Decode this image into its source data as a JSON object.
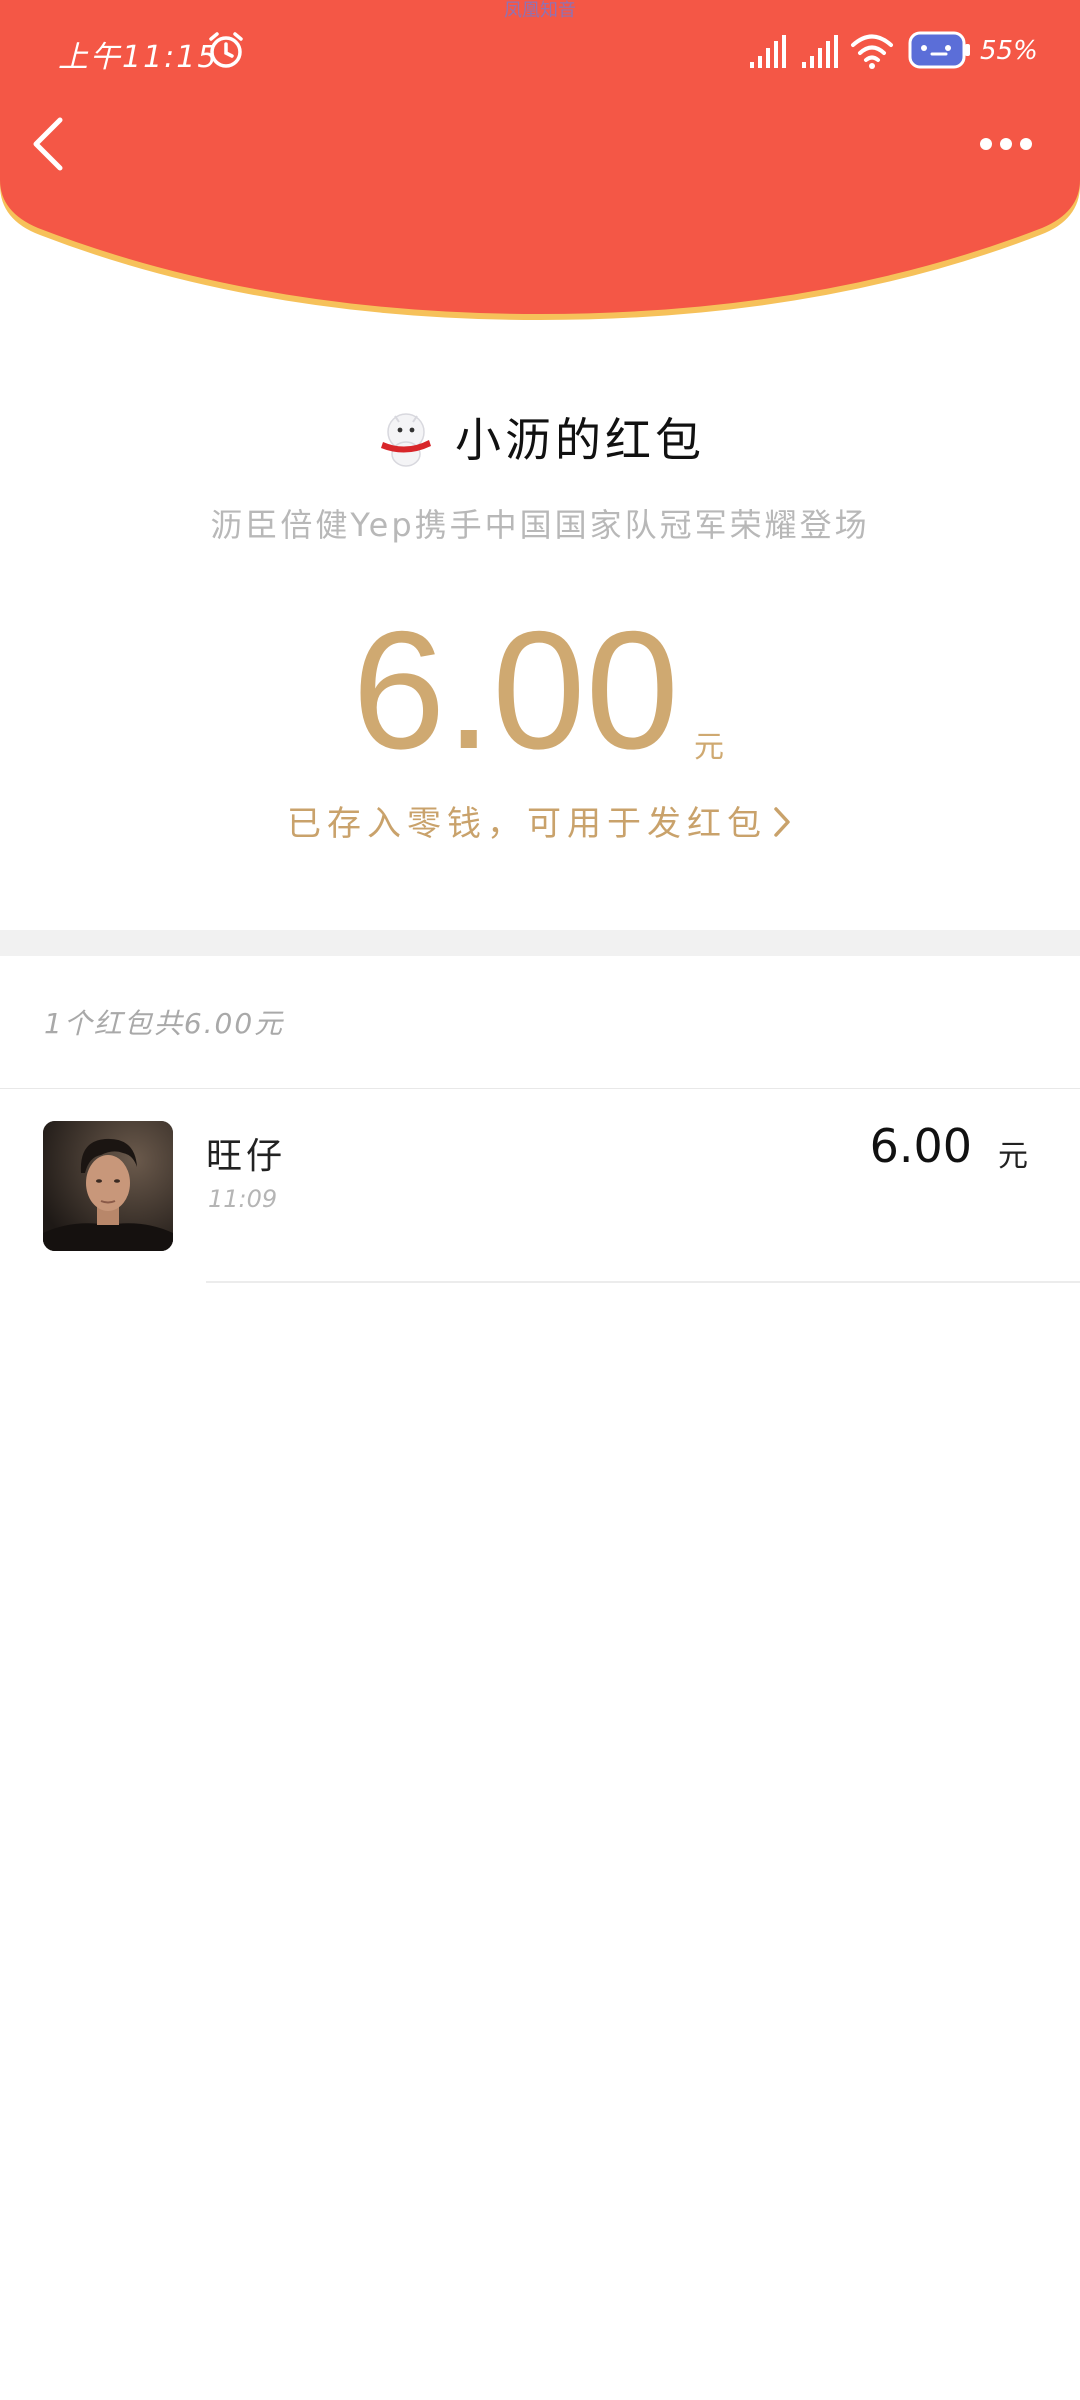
{
  "top_notice": "凤凰知音",
  "status_bar": {
    "time": "上午11:15",
    "battery": "55%"
  },
  "sender": {
    "name": "小沥的红包",
    "blessing": "沥臣倍健Yep携手中国国家队冠军荣耀登场"
  },
  "amount": {
    "value": "6.00",
    "unit": "元",
    "deposit_text": "已存入零钱，可用于发红包"
  },
  "summary": "1个红包共6.00元",
  "receivers": [
    {
      "name": "旺仔",
      "time": "11:09",
      "amount": "6.00",
      "unit": "元"
    }
  ],
  "colors": {
    "header_red": "#f45746",
    "header_border": "#f6c15a",
    "gold": "#cfa971"
  },
  "icons": [
    "alarm-icon",
    "signal-icon",
    "wifi-icon",
    "battery-icon",
    "back-arrow-icon",
    "more-dots-icon",
    "mascot-icon",
    "chevron-right-icon"
  ]
}
